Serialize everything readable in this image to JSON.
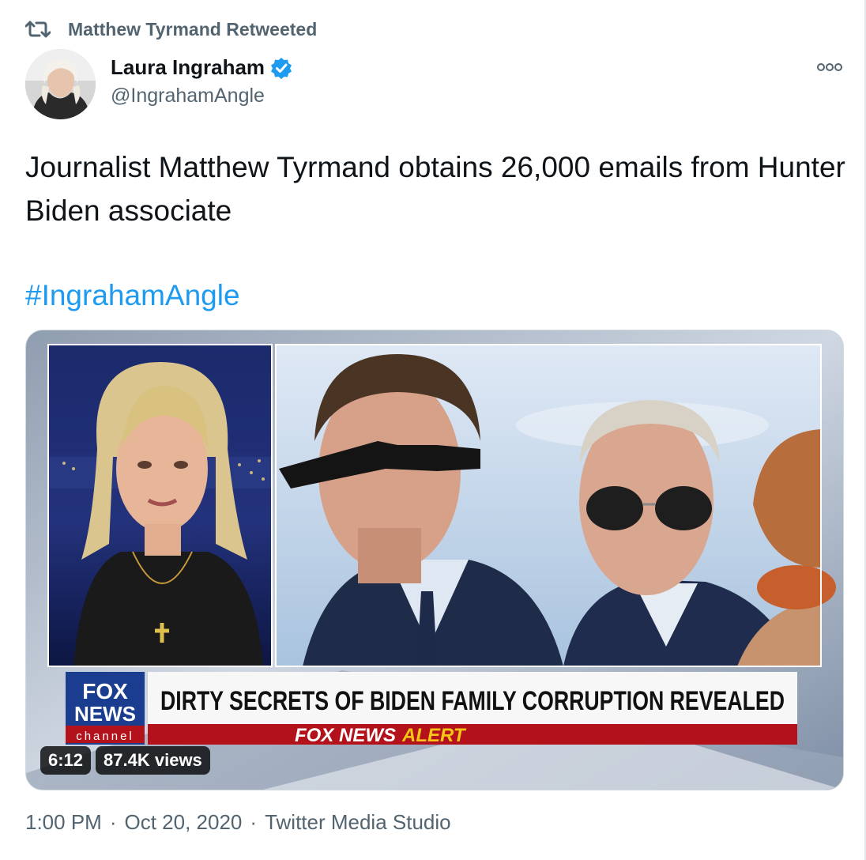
{
  "retweet": {
    "label": "Matthew Tyrmand Retweeted"
  },
  "author": {
    "display_name": "Laura Ingraham",
    "handle": "@IngrahamAngle"
  },
  "tweet": {
    "text": "Journalist Matthew Tyrmand obtains 26,000 emails from Hunter Biden associate",
    "hashtag": "#IngrahamAngle"
  },
  "video": {
    "headline": "DIRTY SECRETS OF BIDEN FAMILY CORRUPTION REVEALED",
    "alert_brand": "FOX NEWS",
    "alert_word": "ALERT",
    "logo_fox": "FOX",
    "logo_news": "NEWS",
    "logo_channel": "channel",
    "duration": "6:12",
    "views": "87.4K views"
  },
  "meta": {
    "time": "1:00 PM",
    "date": "Oct 20, 2020",
    "source": "Twitter Media Studio",
    "separator": "·"
  },
  "colors": {
    "link_blue": "#1d9bf0",
    "secondary_text": "#536471",
    "fox_blue": "#1a3d8f",
    "alert_red": "#b3121b",
    "alert_yellow": "#f5c518"
  }
}
